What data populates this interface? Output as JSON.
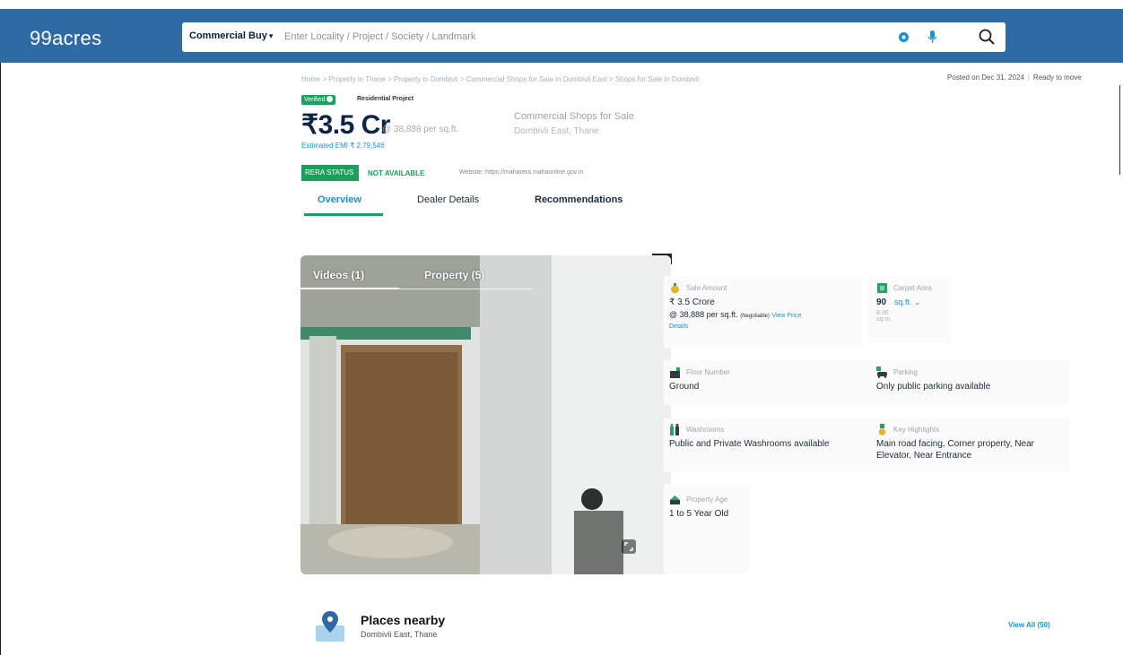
{
  "header": {
    "logo": "99acres",
    "category": "Commercial Buy",
    "search_placeholder": "Enter Locality / Project / Society / Landmark"
  },
  "breadcrumb": "Home > Property in Thane > Property in Dombivli > Commercial Shops for Sale in Dombivli East > Shops for Sale in Dombivli",
  "posted": {
    "date": "Posted on Dec 31, 2024",
    "status": "Ready to move"
  },
  "listing": {
    "verified": "Verified",
    "project_type": "Residential Project",
    "price": "₹3.5 Cr",
    "price_per_sqft": "@ 38,888 per sq.ft.",
    "title": "Commercial Shops for Sale",
    "subtitle": "Dombivli East, Thane",
    "emi": "Estimated EMI ₹ 2,79,546",
    "rera_label": "RERA STATUS",
    "rera_value": "NOT AVAILABLE",
    "website": "Website: https://maharera.mahaonline.gov.in"
  },
  "tabs": [
    "Overview",
    "Dealer Details",
    "Recommendations"
  ],
  "media_tabs": [
    "Videos (1)",
    "Property (5)"
  ],
  "details": {
    "sale_amount": {
      "label": "Sale Amount",
      "value": "₹ 3.5 Crore",
      "per_sqft": "@ 38,888 per sq.ft.",
      "negotiable": "(Negotiable)",
      "link": "View Price",
      "link2": "Details"
    },
    "carpet_area": {
      "label": "Carpet Area",
      "value": "90",
      "unit": "sq.ft.",
      "sub": "8.36 sq.m."
    },
    "floor_number": {
      "label": "Floor Number",
      "value": "Ground"
    },
    "parking": {
      "label": "Parking",
      "value": "Only public parking available"
    },
    "washrooms": {
      "label": "Washrooms",
      "value": "Public and Private Washrooms available"
    },
    "key_highlights": {
      "label": "Key Highlights",
      "value": "Main road facing, Corner property, Near",
      "value2": "Elevator, Near Entrance"
    },
    "property_age": {
      "label": "Property Age",
      "value": "1 to 5 Year Old"
    }
  },
  "places": {
    "title": "Places nearby",
    "subtitle": "Dombivli East, Thane",
    "view_all": "View All (50)"
  },
  "colors": {
    "brand": "#2f6aa5",
    "green": "#19a15b",
    "link": "#1e8fd0"
  },
  "icons": [
    "location-icon",
    "mic-icon",
    "search-icon",
    "expand-icon",
    "map-pin-icon"
  ]
}
